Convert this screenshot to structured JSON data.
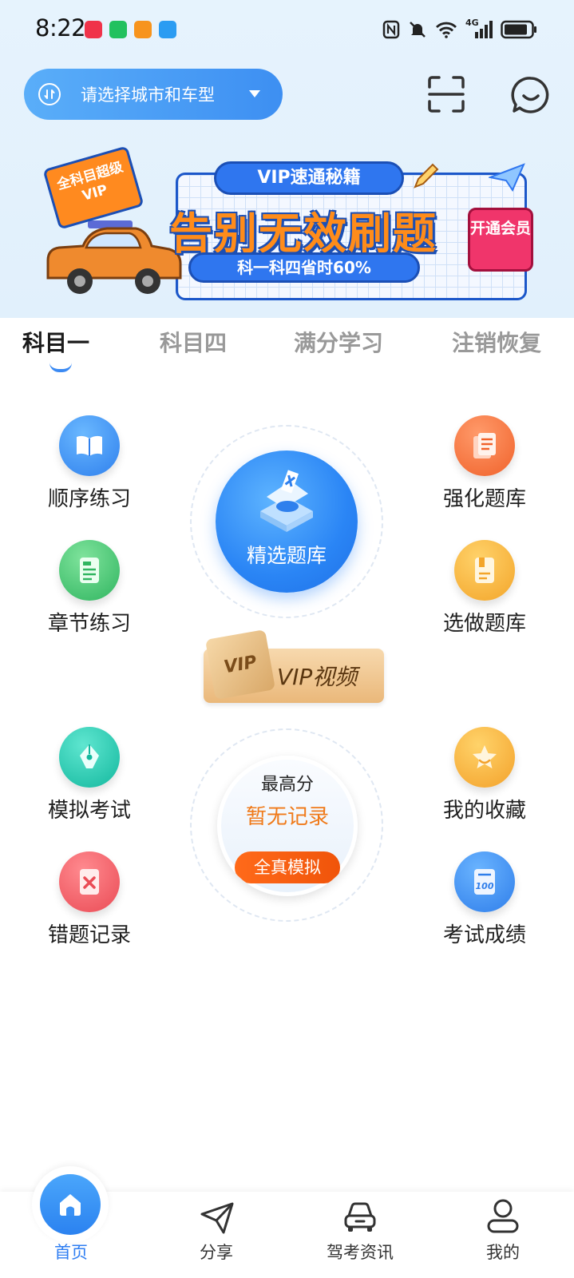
{
  "status_bar": {
    "time": "8:22",
    "network_label": "4G"
  },
  "header": {
    "city_selector_text": "请选择城市和车型"
  },
  "banner": {
    "badge_text": "全科目超级VIP",
    "title_pill": "VIP速通秘籍",
    "headline": "告别无效刷题",
    "sub_pill": "科一科四省时60%",
    "open_button": "开通会员"
  },
  "tabs": [
    {
      "label": "科目一",
      "active": true
    },
    {
      "label": "科目四",
      "active": false
    },
    {
      "label": "满分学习",
      "active": false
    },
    {
      "label": "注销恢复",
      "active": false
    }
  ],
  "features": {
    "sequential_practice": "顺序练习",
    "chapter_practice": "章节练习",
    "intensive_bank": "强化题库",
    "selected_bank": "选做题库",
    "featured_bank": "精选题库",
    "vip_video": "VIP视频",
    "vip_badge": "VIP",
    "mock_exam": "模拟考试",
    "wrong_records": "错题记录",
    "my_favorites": "我的收藏",
    "exam_scores": "考试成绩"
  },
  "score": {
    "title": "最高分",
    "value": "暂无记录",
    "button": "全真模拟"
  },
  "bottom_nav": [
    {
      "label": "首页",
      "active": true
    },
    {
      "label": "分享",
      "active": false
    },
    {
      "label": "驾考资讯",
      "active": false
    },
    {
      "label": "我的",
      "active": false
    }
  ],
  "colors": {
    "primary": "#2f7ef2",
    "orange": "#f07a1a",
    "notif_icons": [
      "#f0334a",
      "#22c15e",
      "#f7941d",
      "#2b9cf2"
    ]
  },
  "icons": {
    "sequential_practice": "book-icon",
    "chapter_practice": "document-icon",
    "intensive_bank": "notes-icon",
    "selected_bank": "folder-icon",
    "mock_exam": "pen-icon",
    "wrong_records": "wrong-icon",
    "my_favorites": "star-icon",
    "exam_scores": "score-100-icon"
  }
}
